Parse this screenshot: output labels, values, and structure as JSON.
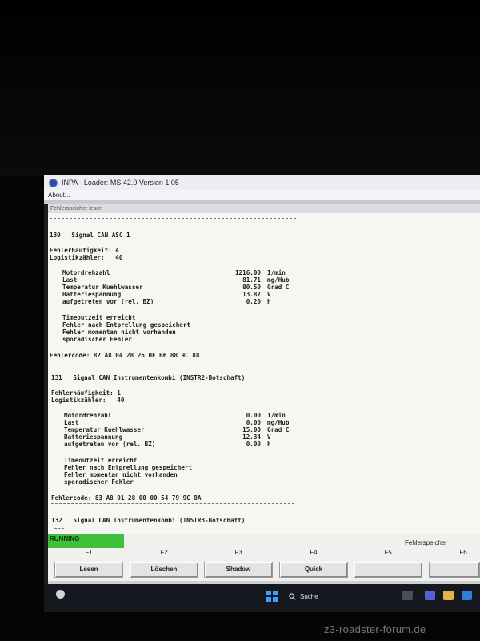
{
  "window": {
    "title": "INPA - Loader:  MS 42.0 Version 1.05"
  },
  "menu": {
    "about": "About..."
  },
  "panel": {
    "title": "Fehlerspeicher lesen"
  },
  "errors": [
    {
      "header": "130   Signal CAN ASC 1",
      "frequency": "Fehlerhäufigkeit: 4",
      "counter": "Logistikzähler:   40",
      "values": [
        {
          "label": "Motordrehzahl",
          "value": "1216.00",
          "unit": "1/min"
        },
        {
          "label": "Last",
          "value": "81.71",
          "unit": "mg/Hub"
        },
        {
          "label": "Temperatur Kuehlwasser",
          "value": "80.50",
          "unit": "Grad C"
        },
        {
          "label": "Batteriespannung",
          "value": "13.87",
          "unit": "V"
        },
        {
          "label": "aufgetreten vor (rel. BZ)",
          "value": "0.20",
          "unit": "h"
        }
      ],
      "status": [
        "Timeoutzeit erreicht",
        "Fehler nach Entprellung gespeichert",
        "Fehler momentan nicht vorhanden",
        "sporadischer Fehler"
      ],
      "code": "Fehlercode: 82 A8 04 28 26 0F B6 88 9C 88"
    },
    {
      "header": "131   Signal CAN Instrumentenkombi (INSTR2-Botschaft)",
      "frequency": "Fehlerhäufigkeit: 1",
      "counter": "Logistikzähler:   40",
      "values": [
        {
          "label": "Motordrehzahl",
          "value": "0.00",
          "unit": "1/min"
        },
        {
          "label": "Last",
          "value": "0.00",
          "unit": "mg/Hub"
        },
        {
          "label": "Temperatur Kuehlwasser",
          "value": "15.00",
          "unit": "Grad C"
        },
        {
          "label": "Batteriespannung",
          "value": "12.34",
          "unit": "V"
        },
        {
          "label": "aufgetreten vor (rel. BZ)",
          "value": "0.00",
          "unit": "h"
        }
      ],
      "status": [
        "Timeoutzeit erreicht",
        "Fehler nach Entprellung gespeichert",
        "Fehler momentan nicht vorhanden",
        "sporadischer Fehler"
      ],
      "code": "Fehlercode: 83 A8 01 28 00 00 54 79 9C 8A"
    },
    {
      "header": "132   Signal CAN Instrumentenkombi (INSTR3-Botschaft)"
    }
  ],
  "status": {
    "running": "RUNNING",
    "mode": "Fehlerspeicher"
  },
  "fkeys": [
    {
      "key": "F1",
      "label": "Lesen"
    },
    {
      "key": "F2",
      "label": "Löschen"
    },
    {
      "key": "F3",
      "label": "Shadow"
    },
    {
      "key": "F4",
      "label": "Quick"
    },
    {
      "key": "F5",
      "label": ""
    },
    {
      "key": "F6",
      "label": ""
    }
  ],
  "taskbar": {
    "search_label": "Suche"
  },
  "watermark": "z3-roadster-forum.de"
}
